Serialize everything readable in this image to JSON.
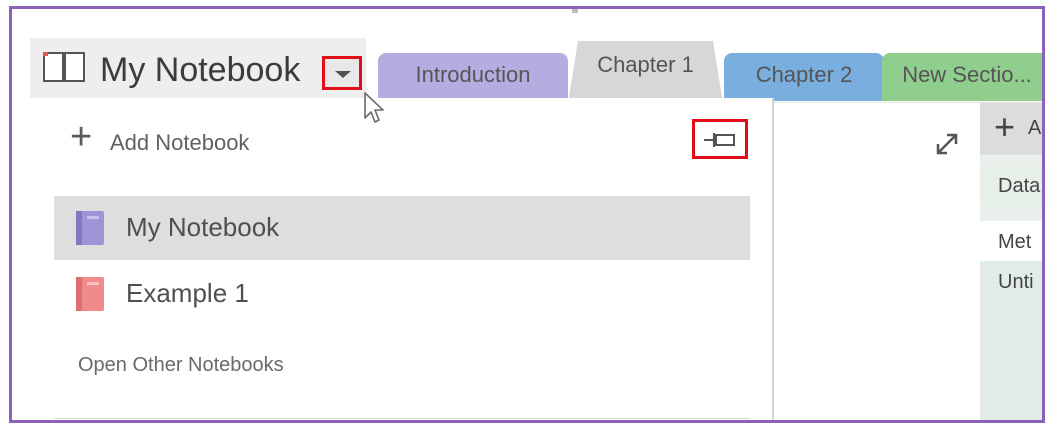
{
  "header": {
    "notebook_title": "My Notebook"
  },
  "tabs": [
    {
      "label": "Introduction",
      "color": "#b4aee0"
    },
    {
      "label": "Chapter 1",
      "color": "#d7d7d7"
    },
    {
      "label": "Chapter 2",
      "color": "#7aaede"
    },
    {
      "label": "New Sectio...",
      "color": "#8fce8d"
    }
  ],
  "dropdown": {
    "add_notebook_label": "Add Notebook",
    "notebooks": [
      {
        "label": "My Notebook",
        "color": "#9e95d6",
        "selected": true
      },
      {
        "label": "Example 1",
        "color": "#ef8b8b",
        "selected": false
      }
    ],
    "open_other_label": "Open Other Notebooks"
  },
  "pages_panel": {
    "add_page_label": "A",
    "rows": [
      "Data",
      "Met",
      "Unti"
    ]
  },
  "colors": {
    "frame_border": "#8a63b8",
    "highlight_box": "#e10e19"
  }
}
